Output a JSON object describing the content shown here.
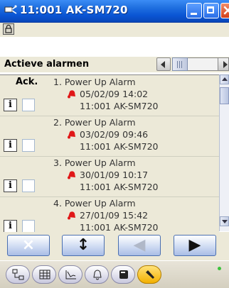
{
  "window": {
    "title": "11:001 AK-SM720",
    "icon": "network-icon"
  },
  "header": {
    "title": "Actieve alarmen"
  },
  "list": {
    "ack_label": "Ack.",
    "info_label": "i",
    "items": [
      {
        "line1": "1. Power Up Alarm",
        "datetime": "05/02/09 14:02",
        "source": "11:001 AK-SM720"
      },
      {
        "line1": "2. Power Up Alarm",
        "datetime": "03/02/09 09:46",
        "source": "11:001 AK-SM720"
      },
      {
        "line1": "3. Power Up Alarm",
        "datetime": "30/01/09 10:17",
        "source": "11:001 AK-SM720"
      },
      {
        "line1": "4. Power Up Alarm",
        "datetime": "27/01/09 15:42",
        "source": "11:001 AK-SM720"
      }
    ]
  },
  "actions": [
    {
      "name": "cancel-button",
      "icon": "×"
    },
    {
      "name": "refresh-button",
      "icon": "↕"
    },
    {
      "name": "back-button",
      "icon": "◀"
    },
    {
      "name": "forward-button",
      "icon": "▶"
    }
  ],
  "colors": {
    "titlebar": "#0a55d4",
    "alarm_bell": "#e01818",
    "nav_active": "#f3b000"
  }
}
